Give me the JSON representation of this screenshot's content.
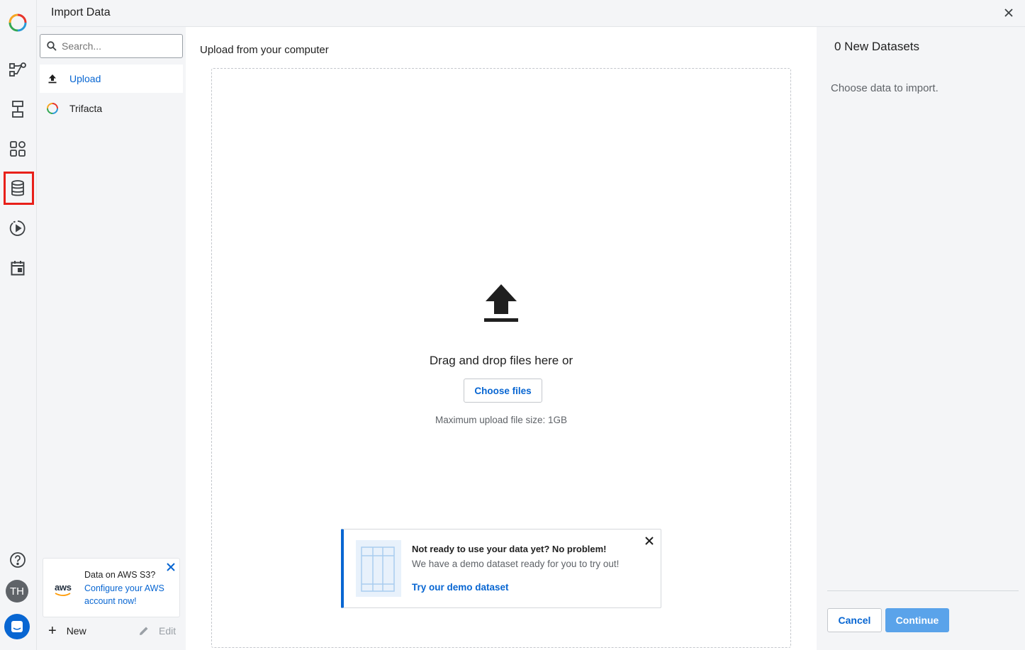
{
  "header": {
    "title": "Import Data"
  },
  "rail": {
    "items": [
      {
        "icon": "trifacta-logo-icon"
      },
      {
        "icon": "flows-icon"
      },
      {
        "icon": "plans-icon"
      },
      {
        "icon": "library-icon"
      },
      {
        "icon": "datasets-icon",
        "highlighted": true
      },
      {
        "icon": "jobs-icon"
      },
      {
        "icon": "calendar-icon"
      },
      {
        "icon": "help-icon"
      }
    ],
    "avatar": "TH",
    "highlight_color": "#e8201a"
  },
  "sidebar": {
    "search_placeholder": "Search...",
    "items": [
      {
        "label": "Upload",
        "icon": "upload-icon",
        "active": true
      },
      {
        "label": "Trifacta",
        "icon": "trifacta-icon",
        "active": false
      }
    ],
    "aws_card": {
      "logo": "aws",
      "title": "Data on AWS S3?",
      "link": "Configure your AWS account now!"
    },
    "new_label": "New",
    "edit_label": "Edit"
  },
  "main": {
    "heading": "Upload from your computer",
    "drop_text": "Drag and drop files here or",
    "choose_label": "Choose files",
    "max_size": "Maximum upload file size: 1GB",
    "demo": {
      "title": "Not ready to use your data yet? No problem!",
      "subtitle": "We have a demo dataset ready for you to try out!",
      "link": "Try our demo dataset"
    }
  },
  "right": {
    "count_label": "0 New Datasets",
    "hint": "Choose data to import.",
    "cancel_label": "Cancel",
    "continue_label": "Continue"
  },
  "colors": {
    "accent": "#0866d2",
    "continue_bg": "#5aa3ea"
  }
}
